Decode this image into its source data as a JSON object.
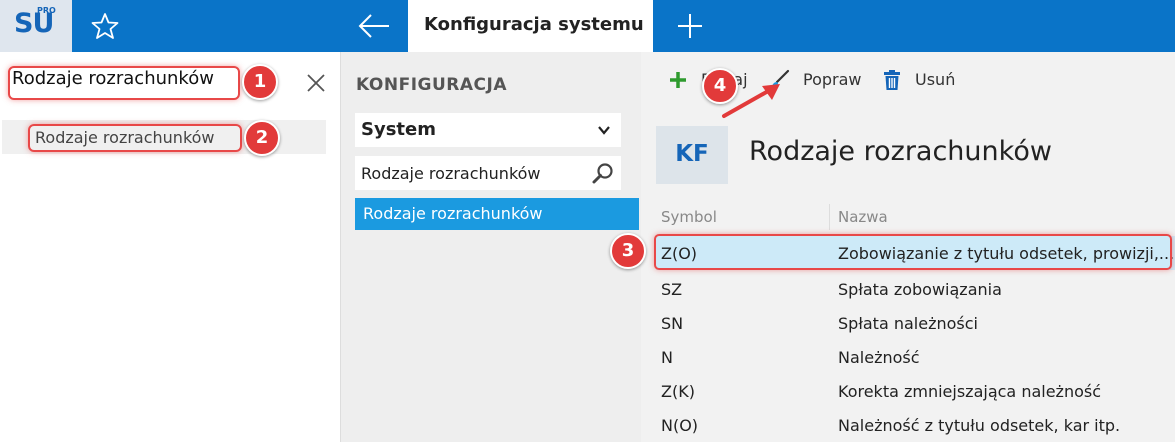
{
  "topbar": {
    "logo_text": "SU",
    "logo_sup": "PRO",
    "active_tab": "Konfiguracja systemu"
  },
  "left_panel": {
    "search_value": "Rodzaje rozrachunków",
    "result_item": "Rodzaje rozrachunków"
  },
  "middle_panel": {
    "title": "KONFIGURACJA",
    "select_value": "System",
    "search_value": "Rodzaje rozrachunków",
    "selected_item": "Rodzaje rozrachunków"
  },
  "toolbar": {
    "add_label": "Dodaj",
    "edit_label": "Popraw",
    "delete_label": "Usuń"
  },
  "record": {
    "badge": "KF",
    "title": "Rodzaje rozrachunków"
  },
  "table": {
    "columns": [
      "Symbol",
      "Nazwa"
    ],
    "rows": [
      {
        "symbol": "Z(O)",
        "name": "Zobowiązanie z tytułu odsetek, prowizji,..."
      },
      {
        "symbol": "SZ",
        "name": "Spłata zobowiązania"
      },
      {
        "symbol": "SN",
        "name": "Spłata należności"
      },
      {
        "symbol": "N",
        "name": "Należność"
      },
      {
        "symbol": "Z(K)",
        "name": "Korekta zmniejszająca należność"
      },
      {
        "symbol": "N(O)",
        "name": "Należność z tytułu odsetek, kar itp."
      }
    ]
  },
  "callouts": [
    "1",
    "2",
    "3",
    "4"
  ],
  "colors": {
    "topbar": "#0a74c8",
    "selected_item": "#1b9ae0",
    "selected_row": "#cdeaf8",
    "callout": "#e23a3a",
    "add_icon": "#2e9b2e",
    "delete_icon": "#1565b8"
  }
}
